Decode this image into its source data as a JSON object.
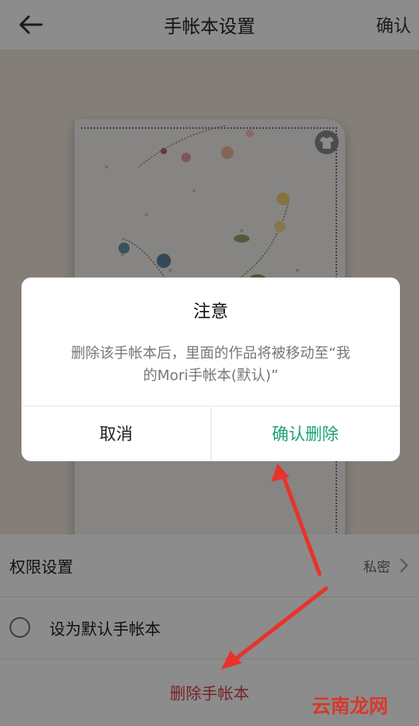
{
  "header": {
    "title": "手帐本设置",
    "confirm_label": "确认"
  },
  "settings": {
    "permission_label": "权限设置",
    "permission_value": "私密",
    "default_label": "设为默认手帐本",
    "delete_label": "删除手帐本"
  },
  "dialog": {
    "title": "注意",
    "message_line1": "删除该手帐本后，里面的作品将被移动至“我",
    "message_line2": "的Mori手帐本(默认)”",
    "cancel_label": "取消",
    "confirm_label": "确认删除"
  },
  "watermark": "云南龙网",
  "colors": {
    "accent": "#1ea17a",
    "danger": "#d9414a",
    "annotation": "#e8332b"
  },
  "icons": {
    "back": "arrow-left-icon",
    "shirt": "shirt-icon",
    "chevron": "chevron-right-icon"
  }
}
